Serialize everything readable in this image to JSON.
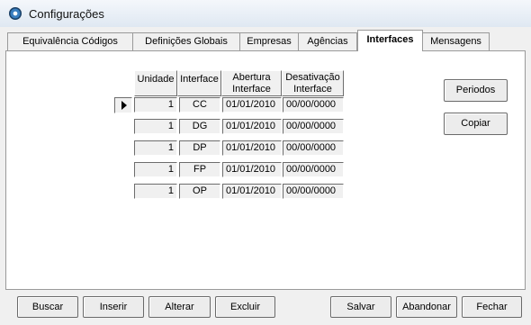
{
  "window": {
    "title": "Configurações"
  },
  "tabs": [
    {
      "label": "Equivalência Códigos"
    },
    {
      "label": "Definições Globais"
    },
    {
      "label": "Empresas"
    },
    {
      "label": "Agências"
    },
    {
      "label": "Interfaces",
      "active": true
    },
    {
      "label": "Mensagens"
    }
  ],
  "grid": {
    "headers": {
      "unidade": "Unidade",
      "interface": "Interface",
      "abertura_l1": "Abertura",
      "abertura_l2": "Interface",
      "desativacao_l1": "Desativação",
      "desativacao_l2": "Interface"
    },
    "rows": [
      {
        "unidade": "1",
        "interface": "CC",
        "abertura": "01/01/2010",
        "desativacao": "00/00/0000"
      },
      {
        "unidade": "1",
        "interface": "DG",
        "abertura": "01/01/2010",
        "desativacao": "00/00/0000"
      },
      {
        "unidade": "1",
        "interface": "DP",
        "abertura": "01/01/2010",
        "desativacao": "00/00/0000"
      },
      {
        "unidade": "1",
        "interface": "FP",
        "abertura": "01/01/2010",
        "desativacao": "00/00/0000"
      },
      {
        "unidade": "1",
        "interface": "OP",
        "abertura": "01/01/2010",
        "desativacao": "00/00/0000"
      }
    ]
  },
  "side_buttons": {
    "periodos": "Periodos",
    "copiar": "Copiar"
  },
  "bottom_buttons": {
    "buscar": "Buscar",
    "inserir": "Inserir",
    "alterar": "Alterar",
    "excluir": "Excluir",
    "salvar": "Salvar",
    "abandonar": "Abandonar",
    "fechar": "Fechar"
  }
}
